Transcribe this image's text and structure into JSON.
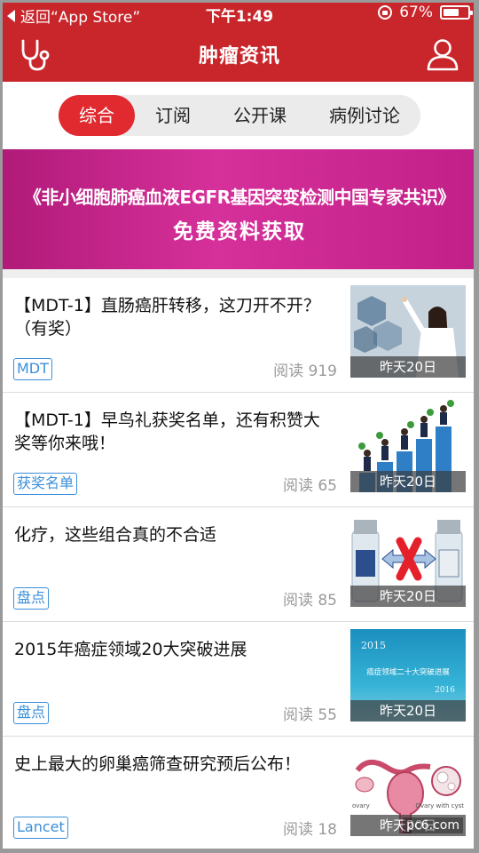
{
  "status_bar": {
    "back_label": "返回“App Store”",
    "time": "下午1:49",
    "battery_percent": "67%",
    "battery_level": 0.67
  },
  "nav": {
    "title": "肿瘤资讯",
    "left_icon": "stethoscope-icon",
    "right_icon": "user-icon"
  },
  "tabs": [
    {
      "label": "综合",
      "active": true
    },
    {
      "label": "订阅",
      "active": false
    },
    {
      "label": "公开课",
      "active": false
    },
    {
      "label": "病例讨论",
      "active": false
    }
  ],
  "banner": {
    "line1": "《非小细胞肺癌血液EGFR基因突变检测中国专家共识》",
    "line2": "免费资料获取"
  },
  "articles": [
    {
      "title": "【MDT-1】直肠癌肝转移，这刀开不开？（有奖）",
      "tag": "MDT",
      "reads": "阅读 919",
      "date": "昨天20日"
    },
    {
      "title": "【MDT-1】早鸟礼获奖名单，还有积赞大奖等你来哦！",
      "tag": "获奖名单",
      "reads": "阅读 65",
      "date": "昨天20日"
    },
    {
      "title": "化疗，这些组合真的不合适",
      "tag": "盘点",
      "reads": "阅读 85",
      "date": "昨天20日"
    },
    {
      "title": "2015年癌症领域20大突破进展",
      "tag": "盘点",
      "reads": "阅读 55",
      "date": "昨天20日",
      "thumb_text": {
        "year": "2015",
        "caption": "癌症领域二十大突破进展",
        "year_bottom": "2016"
      }
    },
    {
      "title": "史上最大的卵巢癌筛查研究预后公布！",
      "tag": "Lancet",
      "reads": "阅读 18",
      "date": "昨天20日",
      "thumb_text": {
        "left": "ovary",
        "right": "Ovary with cyst"
      }
    }
  ],
  "watermark": "pc6.com",
  "colors": {
    "brand_red": "#c9262b",
    "tab_active": "#e02a2f",
    "tag_blue": "#3a8fd9",
    "banner_magenta": "#d6309a"
  }
}
